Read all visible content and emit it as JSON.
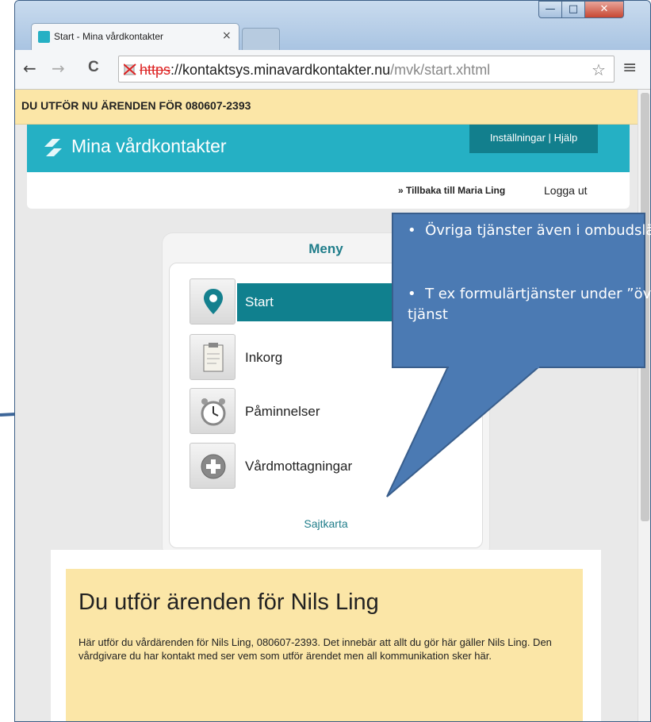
{
  "browser": {
    "tab_title": "Start - Mina vårdkontakter",
    "tab_close": "×",
    "url_https": "https",
    "url_domain": "://kontaktsys.minavardkontakter.nu",
    "url_path": "/mvk/start.xhtml",
    "back": "←",
    "forward": "→",
    "reload": "C",
    "star": "☆",
    "menu": "≡"
  },
  "window_controls": {
    "minimize": "—",
    "maximize": "□",
    "close": "✕"
  },
  "notice": "DU UTFÖR NU ÄRENDEN FÖR 080607-2393",
  "header": {
    "logo_text": "Mina vårdkontakter",
    "settings": "Inställningar",
    "separator": "|",
    "help": "Hjälp"
  },
  "subbar": {
    "back_link": "» Tillbaka till Maria Ling",
    "logout": "Logga ut"
  },
  "menu": {
    "title": "Meny",
    "items": [
      {
        "label": "Start",
        "icon": "map-pin-icon",
        "active": true
      },
      {
        "label": "Inkorg",
        "icon": "clipboard-icon",
        "active": false
      },
      {
        "label": "Påminnelser",
        "icon": "alarm-clock-icon",
        "active": false
      },
      {
        "label": "Vårdmottagningar",
        "icon": "plus-circle-icon",
        "active": false
      }
    ],
    "sitemap": "Sajtkarta"
  },
  "info": {
    "title": "Du utför ärenden för Nils Ling",
    "body": "Här utför du vårdärenden för Nils Ling, 080607-2393. Det innebär att allt du gör här gäller Nils Ling. Den vårdgivare du har kontakt med ser vem som utför ärendet men all kommunikation sker här."
  },
  "callout": {
    "bullets": [
      "Övriga tjänster även i ombudsläge",
      "T ex formulärtjänster under ”övrig” tjänst"
    ]
  },
  "colors": {
    "teal": "#25b0c4",
    "active_teal": "#10808e",
    "notice": "#fbe6a7",
    "callout": "#4b7ab3"
  }
}
